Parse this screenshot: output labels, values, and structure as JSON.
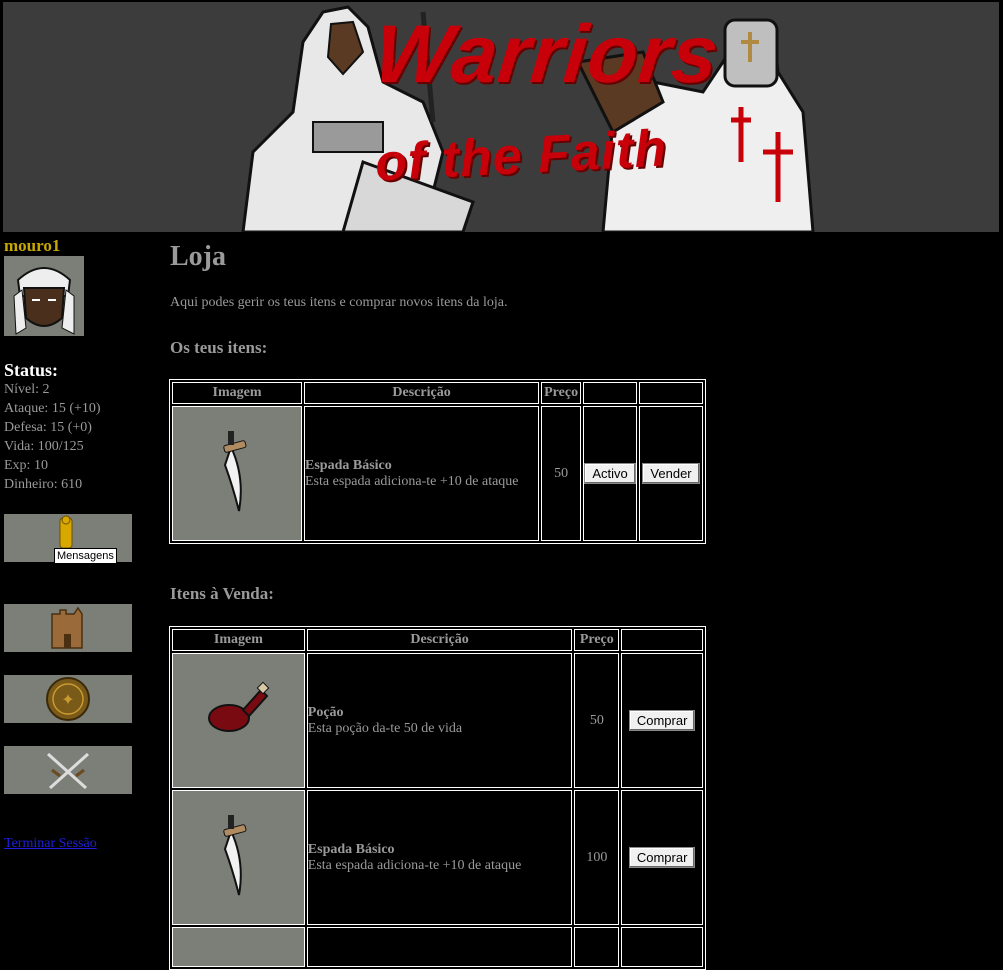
{
  "banner": {
    "title_line1": "Warriors",
    "title_line2": "of the Faith"
  },
  "sidebar": {
    "username": "mouro1",
    "status_title": "Status:",
    "stats": {
      "nivel": "Nível: 2",
      "ataque": "Ataque: 15 (+10)",
      "defesa": "Defesa: 15 (+0)",
      "vida": "Vida: 100/125",
      "exp": "Exp: 10",
      "dinheiro": "Dinheiro: 610"
    },
    "nav": [
      {
        "icon": "scroll-messages-icon",
        "tooltip": "Mensagens"
      },
      {
        "icon": "castle-tower-icon"
      },
      {
        "icon": "gold-coin-icon"
      },
      {
        "icon": "crossed-swords-icon"
      }
    ],
    "logout": "Terminar Sessão"
  },
  "main": {
    "title": "Loja",
    "intro": "Aqui podes gerir os teus itens e comprar novos itens da loja.",
    "my_items_title": "Os teus itens:",
    "for_sale_title": "Itens à Venda:",
    "headers": {
      "image": "Imagem",
      "description": "Descrição",
      "price": "Preço"
    },
    "my_items": [
      {
        "icon": "dagger-icon",
        "name": "Espada Básico",
        "description": "Esta espada adiciona-te +10 de ataque",
        "price": "50",
        "action1": "Activo",
        "action2": "Vender"
      }
    ],
    "for_sale": [
      {
        "icon": "potion-icon",
        "name": "Poção",
        "description": "Esta poção da-te 50 de vida",
        "price": "50",
        "action": "Comprar"
      },
      {
        "icon": "dagger-icon",
        "name": "Espada Básico",
        "description": "Esta espada adiciona-te +10 de ataque",
        "price": "100",
        "action": "Comprar"
      }
    ]
  }
}
